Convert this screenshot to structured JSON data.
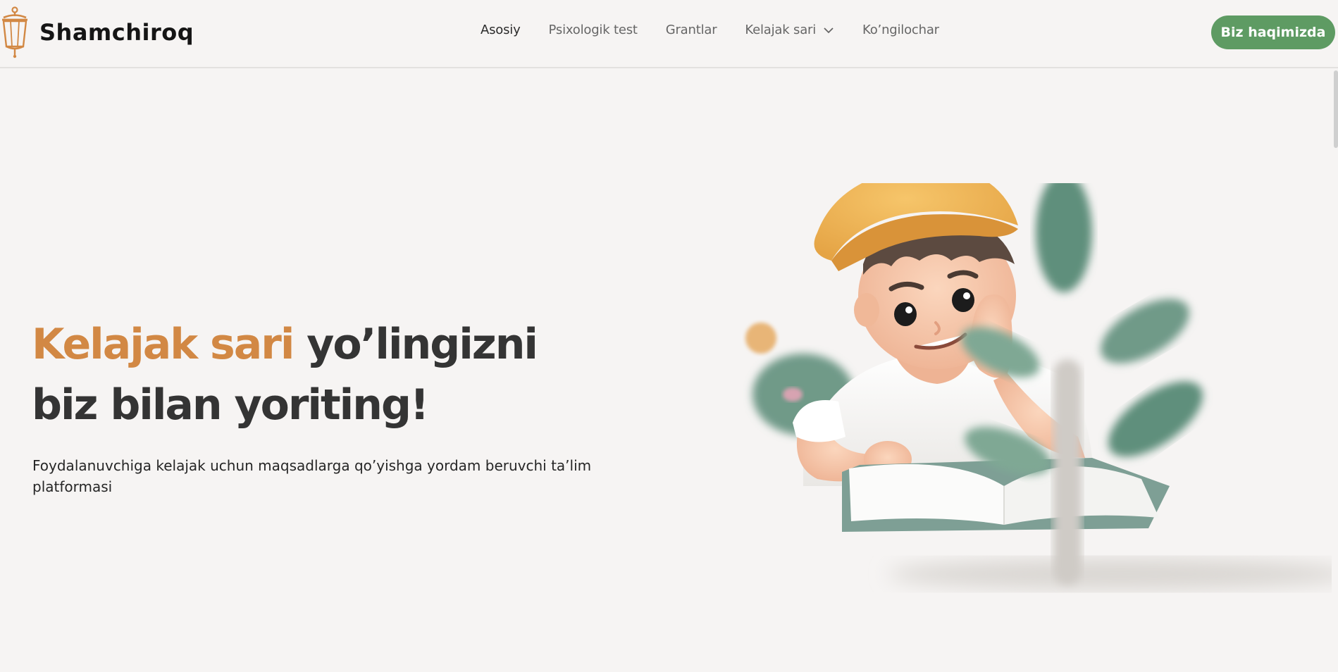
{
  "brand": {
    "name": "Shamchiroq",
    "accent_color": "#d28844"
  },
  "nav": {
    "items": [
      {
        "label": "Asosiy",
        "active": true
      },
      {
        "label": "Psixologik test",
        "active": false
      },
      {
        "label": "Grantlar",
        "active": false
      },
      {
        "label": "Kelajak sari",
        "active": false,
        "has_dropdown": true
      },
      {
        "label": "Ko’ngilochar",
        "active": false
      }
    ]
  },
  "header": {
    "cta_label": "Biz haqimizda",
    "cta_color": "#5e9b63"
  },
  "hero": {
    "title_accent": "Kelajak sari",
    "title_rest_line1": " yo’lingizni",
    "title_line2": "biz bilan yoriting!",
    "subtitle": "Foydalanuvchiga kelajak uchun maqsadlarga qo’yishga yordam beruvchi ta’lim platformasi",
    "illustration": "boy-reading-book-3d"
  }
}
